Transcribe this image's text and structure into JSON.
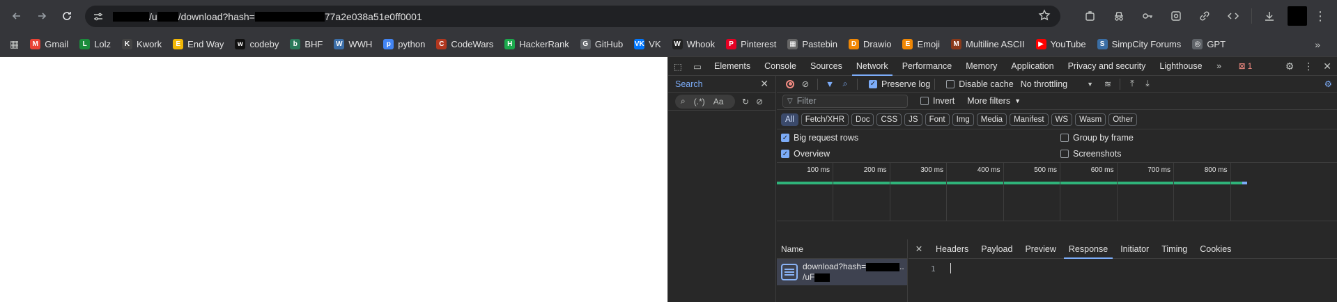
{
  "browser": {
    "url_prefix": "/u",
    "url_middle": "/download?hash=",
    "url_suffix": "77a2e038a51e0ff0001"
  },
  "bookmarks": [
    {
      "label": "Gmail",
      "color": "#ea4335",
      "glyph": "M"
    },
    {
      "label": "Lolz",
      "color": "#1b8c3c",
      "glyph": "L"
    },
    {
      "label": "Kwork",
      "color": "#444444",
      "glyph": "K"
    },
    {
      "label": "End Way",
      "color": "#f2b705",
      "glyph": "E"
    },
    {
      "label": "codeby",
      "color": "#111111",
      "glyph": "w"
    },
    {
      "label": "BHF",
      "color": "#2a7a5a",
      "glyph": "b"
    },
    {
      "label": "WWH",
      "color": "#3b6ea8",
      "glyph": "W"
    },
    {
      "label": "python",
      "color": "#4285f4",
      "glyph": "p"
    },
    {
      "label": "CodeWars",
      "color": "#b1361e",
      "glyph": "C"
    },
    {
      "label": "HackerRank",
      "color": "#1ba94c",
      "glyph": "H"
    },
    {
      "label": "GitHub",
      "color": "#5f6368",
      "glyph": "G"
    },
    {
      "label": "VK",
      "color": "#0077ff",
      "glyph": "VK"
    },
    {
      "label": "Whook",
      "color": "#222222",
      "glyph": "W"
    },
    {
      "label": "Pinterest",
      "color": "#e60023",
      "glyph": "P"
    },
    {
      "label": "Pastebin",
      "color": "#666666",
      "glyph": "▦"
    },
    {
      "label": "Drawio",
      "color": "#f08705",
      "glyph": "D"
    },
    {
      "label": "Emoji",
      "color": "#f08705",
      "glyph": "E"
    },
    {
      "label": "Multiline ASCII",
      "color": "#8b3a1a",
      "glyph": "M"
    },
    {
      "label": "YouTube",
      "color": "#ff0000",
      "glyph": "▶"
    },
    {
      "label": "SimpCity Forums",
      "color": "#3a6ea5",
      "glyph": "S"
    },
    {
      "label": "GPT",
      "color": "#5f6368",
      "glyph": "◎"
    }
  ],
  "devtools": {
    "tabs": [
      "Elements",
      "Console",
      "Sources",
      "Network",
      "Performance",
      "Memory",
      "Application",
      "Privacy and security",
      "Lighthouse"
    ],
    "error_count": "1",
    "search_title": "Search",
    "search_regex": "(.*)",
    "search_case": "Aa",
    "network": {
      "preserve_log": "Preserve log",
      "disable_cache": "Disable cache",
      "throttling": "No throttling",
      "filter_placeholder": "Filter",
      "invert": "Invert",
      "more_filters": "More filters",
      "types": [
        "All",
        "Fetch/XHR",
        "Doc",
        "CSS",
        "JS",
        "Font",
        "Img",
        "Media",
        "Manifest",
        "WS",
        "Wasm",
        "Other"
      ],
      "big_rows": "Big request rows",
      "overview": "Overview",
      "group_by_frame": "Group by frame",
      "screenshots": "Screenshots",
      "ticks": [
        "100 ms",
        "200 ms",
        "300 ms",
        "400 ms",
        "500 ms",
        "600 ms",
        "700 ms",
        "800 ms"
      ],
      "name_header": "Name",
      "request_name": "download?hash=",
      "request_path": "/uF",
      "detail_tabs": [
        "Headers",
        "Payload",
        "Preview",
        "Response",
        "Initiator",
        "Timing",
        "Cookies"
      ],
      "line_number": "1"
    }
  }
}
